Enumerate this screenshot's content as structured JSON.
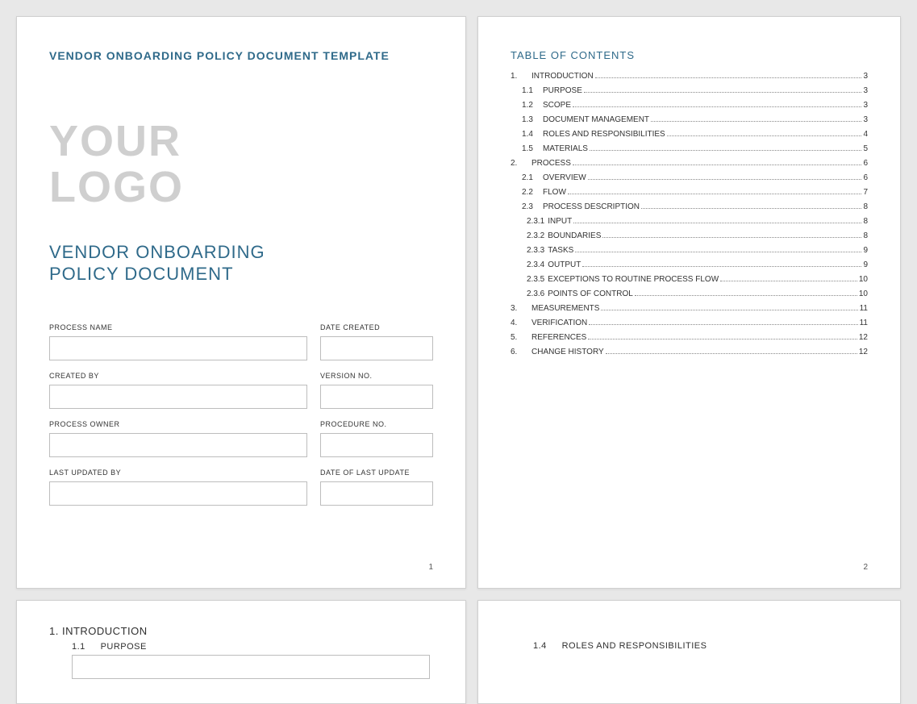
{
  "page1": {
    "template_title": "VENDOR ONBOARDING POLICY DOCUMENT TEMPLATE",
    "logo_line1": "YOUR",
    "logo_line2": "LOGO",
    "subtitle_line1": "VENDOR ONBOARDING",
    "subtitle_line2": "POLICY DOCUMENT",
    "fields": {
      "process_name": {
        "label": "PROCESS NAME",
        "value": ""
      },
      "date_created": {
        "label": "DATE CREATED",
        "value": ""
      },
      "created_by": {
        "label": "CREATED BY",
        "value": ""
      },
      "version_no": {
        "label": "VERSION NO.",
        "value": ""
      },
      "process_owner": {
        "label": "PROCESS OWNER",
        "value": ""
      },
      "procedure_no": {
        "label": "PROCEDURE NO.",
        "value": ""
      },
      "last_updated_by": {
        "label": "LAST UPDATED BY",
        "value": ""
      },
      "date_of_last_update": {
        "label": "DATE OF LAST UPDATE",
        "value": ""
      }
    },
    "page_number": "1"
  },
  "page2": {
    "toc_title": "TABLE OF CONTENTS",
    "entries": [
      {
        "level": 1,
        "num": "1.",
        "label": "INTRODUCTION",
        "page": "3"
      },
      {
        "level": 2,
        "num": "1.1",
        "label": "PURPOSE",
        "page": "3"
      },
      {
        "level": 2,
        "num": "1.2",
        "label": "SCOPE",
        "page": "3"
      },
      {
        "level": 2,
        "num": "1.3",
        "label": "DOCUMENT MANAGEMENT",
        "page": "3"
      },
      {
        "level": 2,
        "num": "1.4",
        "label": "ROLES AND RESPONSIBILITIES",
        "page": "4"
      },
      {
        "level": 2,
        "num": "1.5",
        "label": "MATERIALS",
        "page": "5"
      },
      {
        "level": 1,
        "num": "2.",
        "label": "PROCESS",
        "page": "6"
      },
      {
        "level": 2,
        "num": "2.1",
        "label": "OVERVIEW",
        "page": "6"
      },
      {
        "level": 2,
        "num": "2.2",
        "label": "FLOW",
        "page": "7"
      },
      {
        "level": 2,
        "num": "2.3",
        "label": "PROCESS DESCRIPTION",
        "page": "8"
      },
      {
        "level": 3,
        "num": "2.3.1",
        "label": "INPUT",
        "page": "8"
      },
      {
        "level": 3,
        "num": "2.3.2",
        "label": "BOUNDARIES",
        "page": "8"
      },
      {
        "level": 3,
        "num": "2.3.3",
        "label": "TASKS",
        "page": "9"
      },
      {
        "level": 3,
        "num": "2.3.4",
        "label": "OUTPUT",
        "page": "9"
      },
      {
        "level": 3,
        "num": "2.3.5",
        "label": "EXCEPTIONS TO ROUTINE PROCESS FLOW",
        "page": "10"
      },
      {
        "level": 3,
        "num": "2.3.6",
        "label": "POINTS OF CONTROL",
        "page": "10"
      },
      {
        "level": 1,
        "num": "3.",
        "label": "MEASUREMENTS",
        "page": "11"
      },
      {
        "level": 1,
        "num": "4.",
        "label": "VERIFICATION",
        "page": "11"
      },
      {
        "level": 1,
        "num": "5.",
        "label": "REFERENCES",
        "page": "12"
      },
      {
        "level": 1,
        "num": "6.",
        "label": "CHANGE HISTORY",
        "page": "12"
      }
    ],
    "page_number": "2"
  },
  "page3": {
    "h1_num": "1.",
    "h1_label": "INTRODUCTION",
    "h2_num": "1.1",
    "h2_label": "PURPOSE"
  },
  "page4": {
    "h2_num": "1.4",
    "h2_label": "ROLES AND RESPONSIBILITIES"
  }
}
